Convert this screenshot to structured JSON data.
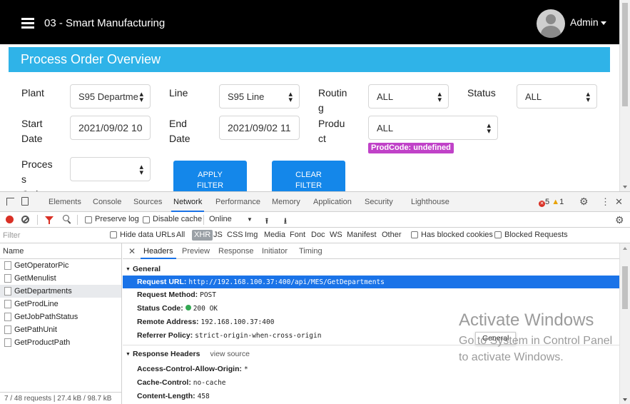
{
  "app": {
    "title": "03 - Smart Manufacturing",
    "user": "Admin",
    "card_title": "Process Order Overview"
  },
  "form": {
    "plant_label": "Plant",
    "plant_value": "S95 Departme",
    "line_label": "Line",
    "line_value": "S95 Line",
    "routing_label_1": "Routin",
    "routing_label_2": "g",
    "routing_value": "ALL",
    "status_label": "Status",
    "status_value": "ALL",
    "start_label_1": "Start",
    "start_label_2": "Date",
    "start_value": "2021/09/02 10",
    "end_label_1": "End",
    "end_label_2": "Date",
    "end_value": "2021/09/02 11",
    "product_label_1": "Produ",
    "product_label_2": "ct",
    "product_value": "ALL",
    "prodcode_badge": "ProdCode: undefined",
    "process_label_1": "Proces",
    "process_label_2": "s",
    "process_label_3": "Order",
    "process_value": "",
    "apply_line_1": "APPLY",
    "apply_line_2": "FILTER",
    "clear_line_1": "CLEAR",
    "clear_line_2": "FILTER"
  },
  "devtools": {
    "tabs": [
      "Elements",
      "Console",
      "Sources",
      "Network",
      "Performance",
      "Memory",
      "Application",
      "Security",
      "Lighthouse"
    ],
    "active_tab": "Network",
    "errors": "5",
    "warnings": "1",
    "toolbar": {
      "preserve_log": "Preserve log",
      "disable_cache": "Disable cache",
      "throttle": "Online"
    },
    "filter": {
      "placeholder": "Filter",
      "hide_data_urls": "Hide data URLs",
      "types": [
        "All",
        "XHR",
        "JS",
        "CSS",
        "Img",
        "Media",
        "Font",
        "Doc",
        "WS",
        "Manifest",
        "Other"
      ],
      "active_type": "XHR",
      "has_blocked_cookies": "Has blocked cookies",
      "blocked_requests": "Blocked Requests"
    },
    "name_header": "Name",
    "requests": [
      "GetOperatorPic",
      "GetMenulist",
      "GetDepartments",
      "GetProdLine",
      "GetJobPathStatus",
      "GetPathUnit",
      "GetProductPath"
    ],
    "selected_request": "GetDepartments",
    "status_bar": "7 / 48 requests  |  27.4 kB / 98.7 kB",
    "detail_tabs": [
      "Headers",
      "Preview",
      "Response",
      "Initiator",
      "Timing"
    ],
    "active_detail_tab": "Headers",
    "general_label": "General",
    "general": {
      "request_url_key": "Request URL:",
      "request_url": "http://192.168.100.37:400/api/MES/GetDepartments",
      "method_key": "Request Method:",
      "method": "POST",
      "status_key": "Status Code:",
      "status": "200 OK",
      "remote_key": "Remote Address:",
      "remote": "192.168.100.37:400",
      "referrer_key": "Referrer Policy:",
      "referrer": "strict-origin-when-cross-origin"
    },
    "tooltip": "General",
    "response_headers_label": "Response Headers",
    "view_source": "view source",
    "response_headers": {
      "acao_key": "Access-Control-Allow-Origin:",
      "acao": "*",
      "cache_key": "Cache-Control:",
      "cache": "no-cache",
      "length_key": "Content-Length:",
      "length": "458"
    },
    "colors": {
      "accent": "#1a73e8",
      "error": "#d93025",
      "warning": "#e8a200",
      "ok": "#34a853"
    }
  },
  "watermark": {
    "line1": "Activate Windows",
    "line2": "Go to System in Control Panel to activate Windows."
  }
}
